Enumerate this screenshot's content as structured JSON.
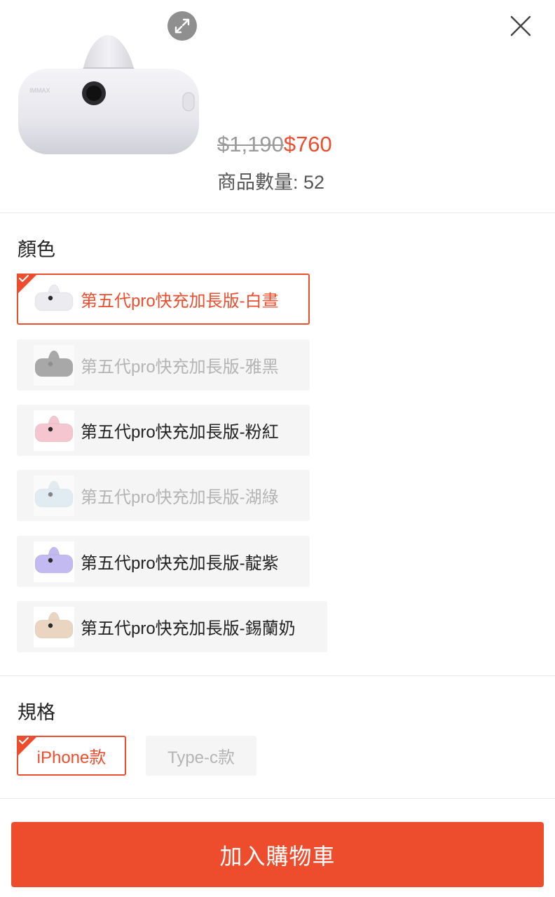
{
  "product": {
    "original_price": "$1,190",
    "sale_price": "$760",
    "quantity_label": "商品數量: 52"
  },
  "color_section": {
    "title": "顏色",
    "options": [
      {
        "label": "第五代pro快充加長版-白晝",
        "state": "selected",
        "color": "#ececf0",
        "port": "#2a2a2a"
      },
      {
        "label": "第五代pro快充加長版-雅黑",
        "state": "disabled",
        "color": "#6b6b6b",
        "port": "#3a3a3a"
      },
      {
        "label": "第五代pro快充加長版-粉紅",
        "state": "normal",
        "color": "#f5c6cf",
        "port": "#2a2a2a"
      },
      {
        "label": "第五代pro快充加長版-湖綠",
        "state": "disabled",
        "color": "#cfe6ee",
        "port": "#2a2a2a"
      },
      {
        "label": "第五代pro快充加長版-靛紫",
        "state": "normal",
        "color": "#c2baf0",
        "port": "#2a2a2a"
      },
      {
        "label": "第五代pro快充加長版-錫蘭奶",
        "state": "normal",
        "color": "#ead6c0",
        "port": "#2a2a2a"
      }
    ]
  },
  "spec_section": {
    "title": "規格",
    "options": [
      {
        "label": "iPhone款",
        "state": "selected"
      },
      {
        "label": "Type-c款",
        "state": "disabled"
      }
    ]
  },
  "footer": {
    "add_to_cart": "加入購物車"
  },
  "colors": {
    "accent": "#ee4d2d",
    "disabled_text": "#b4b4b4",
    "option_bg": "#f5f5f5"
  },
  "icons": [
    "expand-icon",
    "close-icon",
    "checkmark-icon"
  ]
}
